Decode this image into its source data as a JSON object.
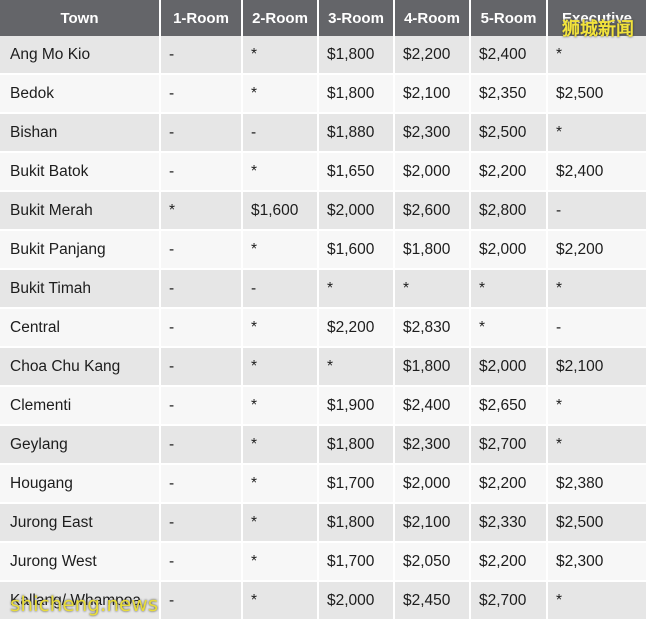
{
  "table": {
    "headers": [
      "Town",
      "1-Room",
      "2-Room",
      "3-Room",
      "4-Room",
      "5-Room",
      "Executive"
    ],
    "rows": [
      [
        "Ang Mo Kio",
        "-",
        "*",
        "$1,800",
        "$2,200",
        "$2,400",
        "*"
      ],
      [
        "Bedok",
        "-",
        "*",
        "$1,800",
        "$2,100",
        "$2,350",
        "$2,500"
      ],
      [
        "Bishan",
        "-",
        "-",
        "$1,880",
        "$2,300",
        "$2,500",
        "*"
      ],
      [
        "Bukit Batok",
        "-",
        "*",
        "$1,650",
        "$2,000",
        "$2,200",
        "$2,400"
      ],
      [
        "Bukit Merah",
        "*",
        "$1,600",
        "$2,000",
        "$2,600",
        "$2,800",
        "-"
      ],
      [
        "Bukit Panjang",
        "-",
        "*",
        "$1,600",
        "$1,800",
        "$2,000",
        "$2,200"
      ],
      [
        "Bukit Timah",
        "-",
        "-",
        "*",
        "*",
        "*",
        "*"
      ],
      [
        "Central",
        "-",
        "*",
        "$2,200",
        "$2,830",
        "*",
        "-"
      ],
      [
        "Choa Chu Kang",
        "-",
        "*",
        "*",
        "$1,800",
        "$2,000",
        "$2,100"
      ],
      [
        "Clementi",
        "-",
        "*",
        "$1,900",
        "$2,400",
        "$2,650",
        "*"
      ],
      [
        "Geylang",
        "-",
        "*",
        "$1,800",
        "$2,300",
        "$2,700",
        "*"
      ],
      [
        "Hougang",
        "-",
        "*",
        "$1,700",
        "$2,000",
        "$2,200",
        "$2,380"
      ],
      [
        "Jurong East",
        "-",
        "*",
        "$1,800",
        "$2,100",
        "$2,330",
        "$2,500"
      ],
      [
        "Jurong West",
        "-",
        "*",
        "$1,700",
        "$2,050",
        "$2,200",
        "$2,300"
      ],
      [
        "Kallang/ Whampoa",
        "-",
        "*",
        "$2,000",
        "$2,450",
        "$2,700",
        "*"
      ]
    ]
  },
  "watermarks": {
    "top": "狮城新闻",
    "bottom": "shicheng.news"
  }
}
